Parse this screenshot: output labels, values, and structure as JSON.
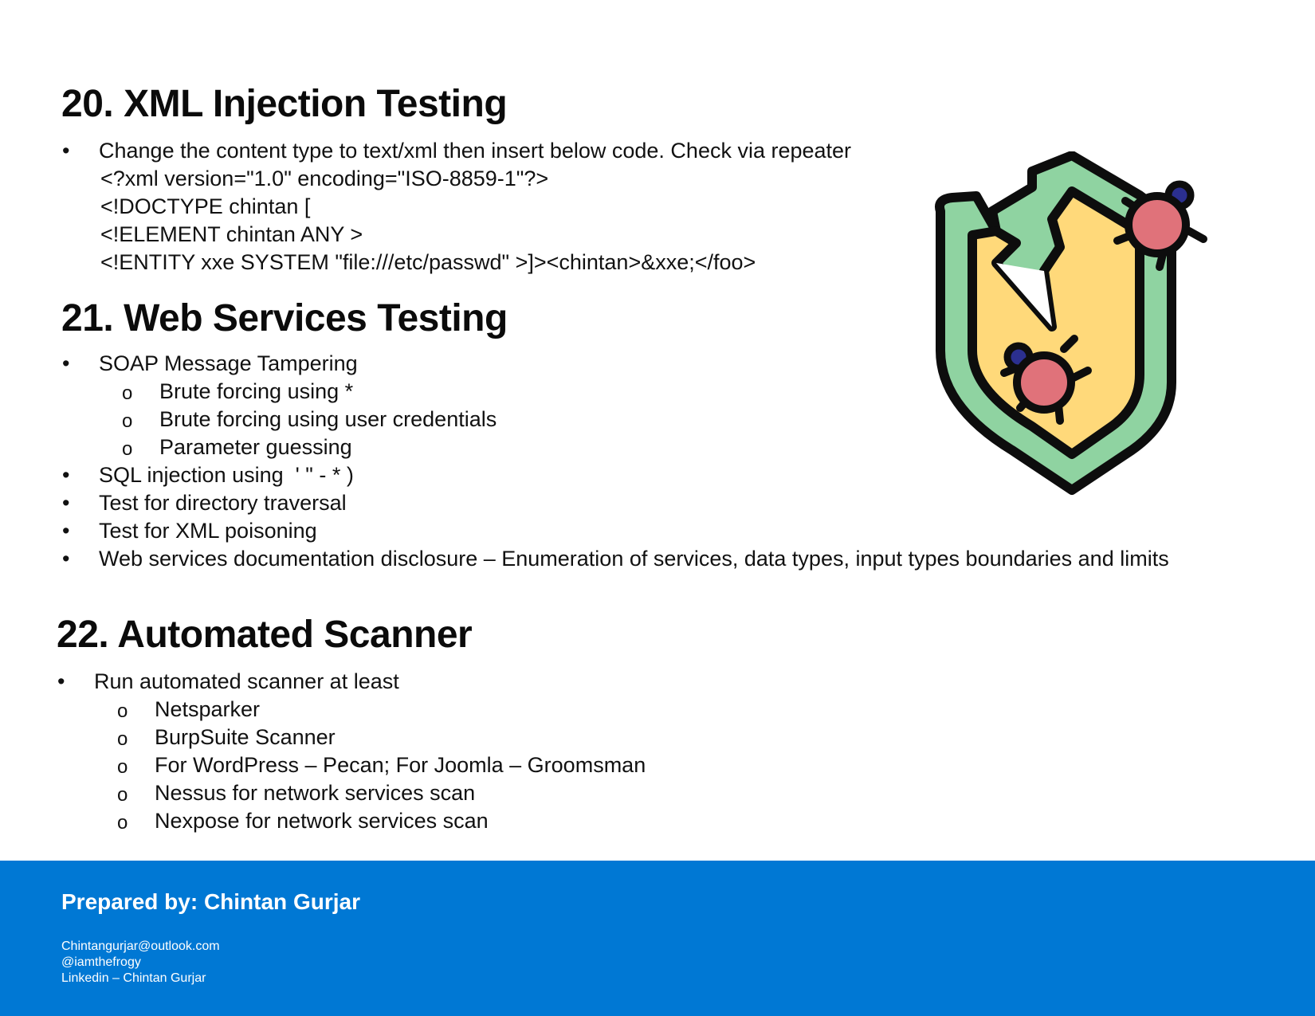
{
  "section20": {
    "title": "20. XML Injection Testing",
    "bullet": "Change the content type to text/xml then insert below code. Check via repeater",
    "code_lines": [
      "<?xml version=\"1.0\" encoding=\"ISO-8859-1\"?>",
      "<!DOCTYPE chintan [",
      "<!ELEMENT chintan ANY >",
      "<!ENTITY xxe SYSTEM \"file:///etc/passwd\" >]><chintan>&xxe;</foo>"
    ]
  },
  "section21": {
    "title": "21. Web Services Testing",
    "bullets": {
      "soap": "SOAP Message Tampering",
      "soap_sub": [
        "Brute forcing using *",
        "Brute forcing using user credentials",
        "Parameter guessing"
      ],
      "sqli": "SQL injection using  ' \" - * )",
      "traversal": "Test for directory traversal",
      "xml_poison": "Test for XML poisoning",
      "docs": "Web services documentation disclosure – Enumeration of services, data types, input types boundaries and limits"
    }
  },
  "section22": {
    "title": "22. Automated Scanner",
    "bullet": "Run automated scanner at least",
    "sub": [
      "Netsparker",
      "BurpSuite Scanner",
      "For WordPress – Pecan; For Joomla – Groomsman",
      "Nessus for network services scan",
      "Nexpose for network services scan"
    ]
  },
  "markers": {
    "bullet": "•",
    "sub": "o"
  },
  "footer": {
    "title": "Prepared by: Chintan Gurjar",
    "email": "Chintangurjar@outlook.com",
    "handle": "@iamthefrogy",
    "linkedin": "Linkedin – Chintan Gurjar"
  },
  "illustration": {
    "icon": "shield-with-bugs-icon"
  },
  "colors": {
    "footer_bg": "#0078d4",
    "shield_outer": "#8fd3a1",
    "shield_inner": "#ffd97a",
    "bug": "#e0727a",
    "bug_head": "#2b2f8f"
  }
}
